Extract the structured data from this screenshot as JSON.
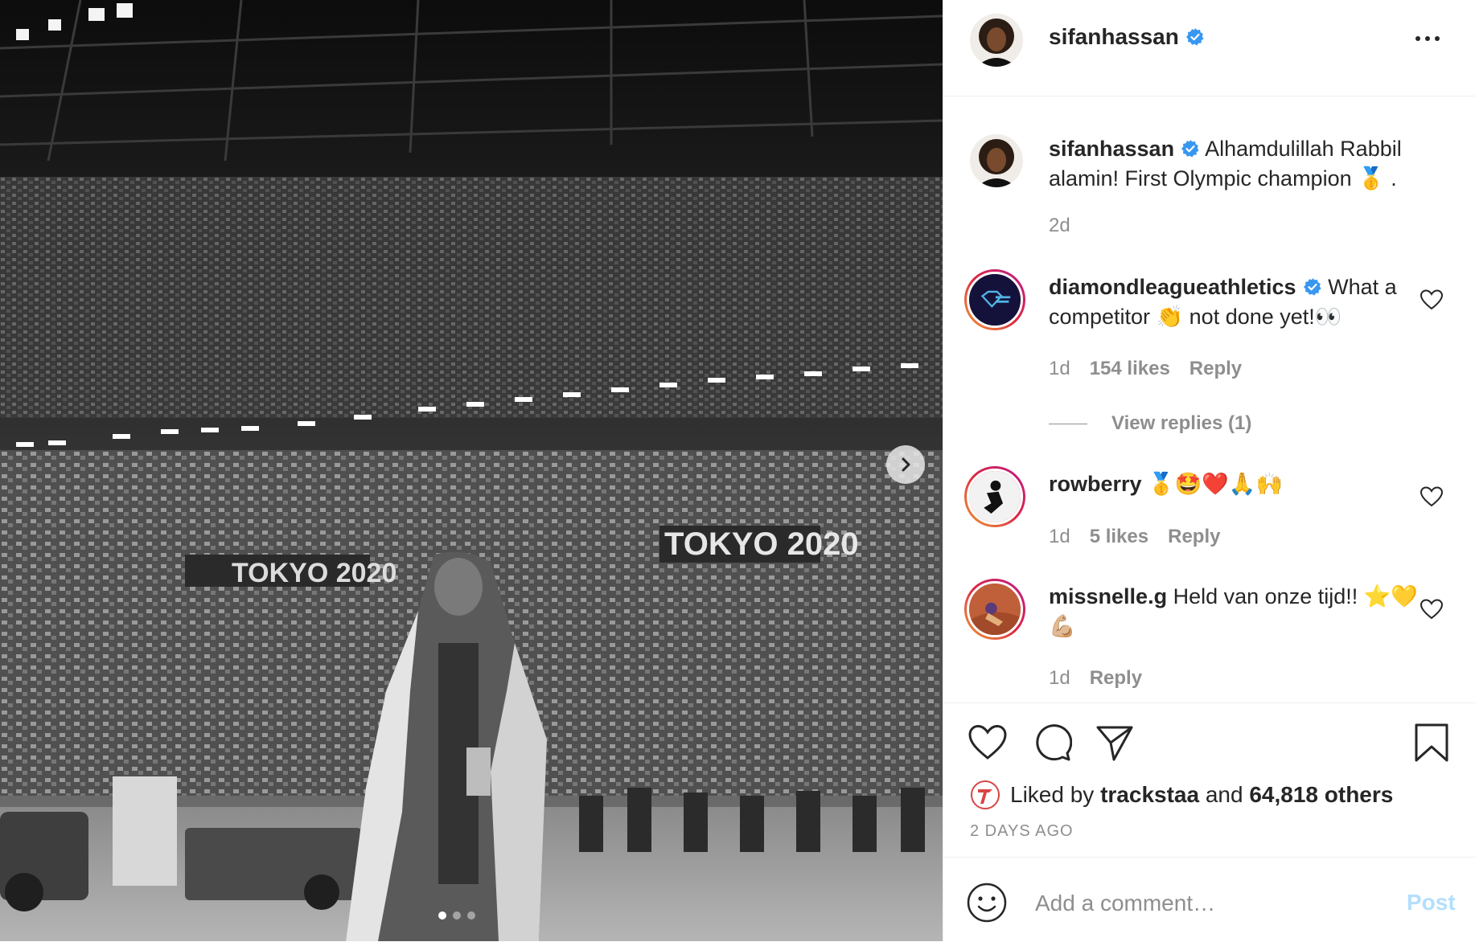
{
  "photo": {
    "banner_left": "TOKYO 2020",
    "banner_right": "TOKYO 2020",
    "carousel_dots": 3,
    "active_dot": 0
  },
  "header": {
    "username": "sifanhassan",
    "verified": true
  },
  "caption": {
    "username": "sifanhassan",
    "text": "Alhamdulillah Rabbil alamin! First Olympic champion 🥇 .",
    "time": "2d"
  },
  "comments": [
    {
      "username": "diamondleagueathletics",
      "verified": true,
      "text": "What a competitor 👏 not done yet!👀",
      "time": "1d",
      "likes": "154 likes",
      "reply": "Reply",
      "view_replies": "View replies (1)"
    },
    {
      "username": "rowberry",
      "verified": false,
      "text": "🥇🤩❤️🙏🙌",
      "time": "1d",
      "likes": "5 likes",
      "reply": "Reply"
    },
    {
      "username": "missnelle.g",
      "verified": false,
      "text": "Held van onze tijd!! ⭐️💛💪🏼",
      "time": "1d",
      "reply": "Reply"
    }
  ],
  "likes": {
    "prefix": "Liked by",
    "user": "trackstaa",
    "and": "and",
    "others": "64,818 others"
  },
  "date": "2 DAYS AGO",
  "add_comment": {
    "placeholder": "Add a comment…",
    "post_label": "Post"
  },
  "colors": {
    "verified": "#3897f0",
    "post_disabled": "#b2dffc",
    "muted": "#8e8e8e",
    "diamond_ring": "#d6249f"
  }
}
